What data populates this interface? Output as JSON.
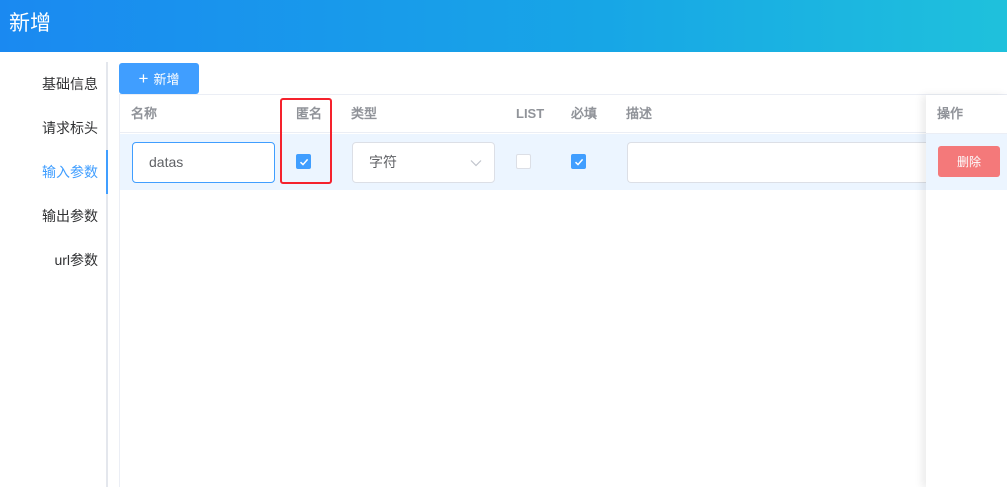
{
  "header": {
    "title": "新增"
  },
  "tabs": [
    {
      "label": "基础信息",
      "active": false
    },
    {
      "label": "请求标头",
      "active": false
    },
    {
      "label": "输入参数",
      "active": true
    },
    {
      "label": "输出参数",
      "active": false
    },
    {
      "label": "url参数",
      "active": false
    }
  ],
  "toolbar": {
    "add_label": "新增",
    "add_icon": "plus-icon"
  },
  "table": {
    "columns": {
      "name": "名称",
      "anonymous": "匿名",
      "type": "类型",
      "list": "LIST",
      "required": "必填",
      "description": "描述",
      "action": "操作"
    },
    "rows": [
      {
        "name": "datas",
        "anonymous": true,
        "type": "字符",
        "list": false,
        "required": true,
        "description": "",
        "delete_label": "删除"
      }
    ]
  },
  "colors": {
    "header_gradient": [
      "#1a89f1",
      "#1fc1dc"
    ],
    "primary": "#409eff",
    "danger": "#f56c6c",
    "annotation": "#f5222d",
    "row_highlight": "#ecf5ff"
  }
}
